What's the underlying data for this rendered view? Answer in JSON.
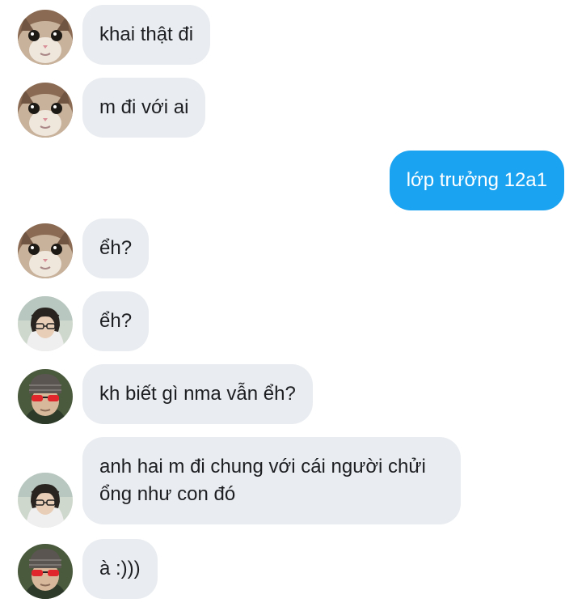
{
  "messages": [
    {
      "sender": "cat",
      "direction": "incoming",
      "text": "khai thật đi"
    },
    {
      "sender": "cat",
      "direction": "incoming",
      "text": "m đi với ai"
    },
    {
      "sender": "me",
      "direction": "outgoing",
      "text": "lớp trưởng 12a1"
    },
    {
      "sender": "cat",
      "direction": "incoming",
      "text": "ểh?"
    },
    {
      "sender": "hoodie-girl",
      "direction": "incoming",
      "text": "ểh?"
    },
    {
      "sender": "beanie-guy",
      "direction": "incoming",
      "text": "kh biết gì nma vẫn ểh?"
    },
    {
      "sender": "hoodie-girl",
      "direction": "incoming",
      "text": "anh hai m đi chung với cái người chửi ổng như con đó"
    },
    {
      "sender": "beanie-guy",
      "direction": "incoming",
      "text": "à :)))"
    }
  ],
  "colors": {
    "incoming_bubble": "#e9ecf0",
    "outgoing_bubble": "#1aa3f0",
    "text_dark": "#1c1e21",
    "text_light": "#ffffff"
  },
  "icons": {
    "cat": "cat-avatar-icon",
    "hoodie-girl": "hoodie-girl-avatar-icon",
    "beanie-guy": "beanie-guy-avatar-icon"
  }
}
